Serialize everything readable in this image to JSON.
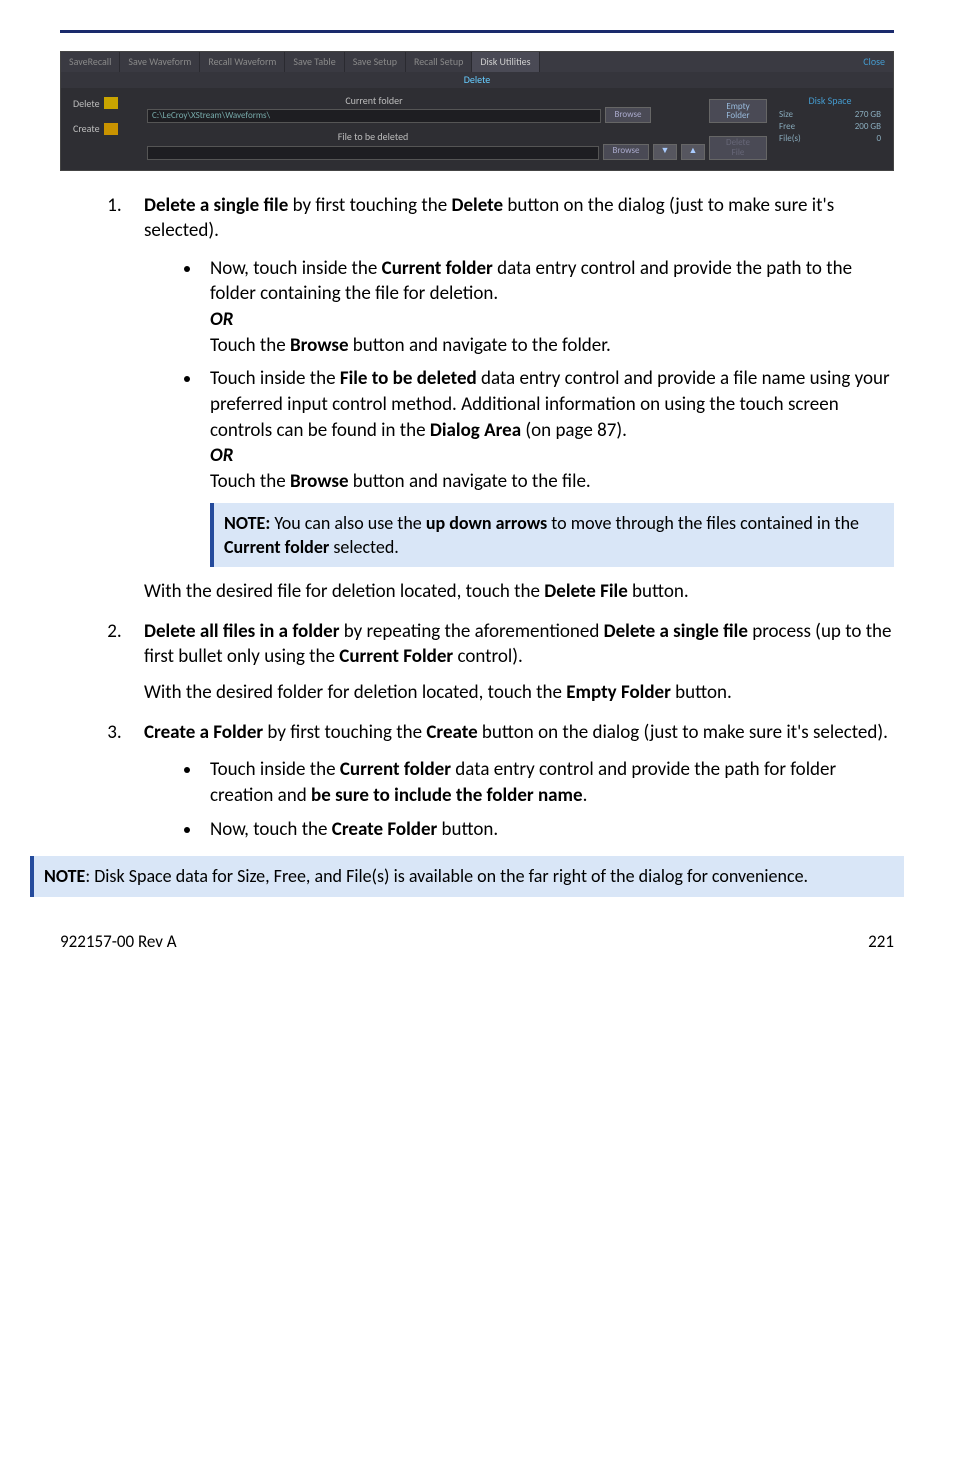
{
  "appshot": {
    "tabs": [
      {
        "label": "SaveRecall"
      },
      {
        "label": "Save Waveform"
      },
      {
        "label": "Recall Waveform"
      },
      {
        "label": "Save Table"
      },
      {
        "label": "Save Setup"
      },
      {
        "label": "Recall Setup"
      },
      {
        "label": "Disk Utilities",
        "active": true
      }
    ],
    "close": "Close",
    "subbar": "Delete",
    "side": {
      "delete": "Delete",
      "create": "Create"
    },
    "fields": {
      "current_folder_label": "Current folder",
      "current_folder_value": "C:\\LeCroy\\XStream\\Waveforms\\",
      "file_label": "File to be deleted",
      "browse": "Browse"
    },
    "actions": {
      "empty": "Empty\nFolder",
      "delete_file": "Delete\nFile"
    },
    "diskspace": {
      "header": "Disk Space",
      "size_l": "Size",
      "size_v": "270 GB",
      "free_l": "Free",
      "free_v": "200 GB",
      "files_l": "File(s)",
      "files_v": "0"
    }
  },
  "step1_lead_a": "Delete a single file",
  "step1_lead_b": " by first touching the ",
  "step1_lead_c": "Delete",
  "step1_lead_d": " button on the dialog (just to make sure it's selected).",
  "s1b1_a": "Now, touch inside the ",
  "s1b1_b": "Current folder",
  "s1b1_c": " data entry control and provide the path to the folder containing the file for deletion.",
  "or": "OR",
  "s1b1_d": "Touch the ",
  "s1b1_e": "Browse",
  "s1b1_f": " button and navigate to the folder.",
  "s1b2_a": "Touch inside the ",
  "s1b2_b": "File to be deleted",
  "s1b2_c": " data entry control and provide a file name using your preferred input control method. Additional information on using the touch screen controls can be found in the ",
  "s1b2_d": "Dialog Area",
  "s1b2_e": " (on page 87).",
  "s1b2_f": "Touch the ",
  "s1b2_g": "Browse",
  "s1b2_h": " button and navigate to the file.",
  "note1_a": "NOTE:",
  "note1_b": " You can also use the ",
  "note1_c": "up down arrows",
  "note1_d": " to move through the files contained in the ",
  "note1_e": "Current folder",
  "note1_f": " selected.",
  "s1after_a": "With the desired file for deletion located, touch the ",
  "s1after_b": "Delete File",
  "s1after_c": " button.",
  "step2_a": "Delete all files in a folder",
  "step2_b": " by repeating the aforementioned ",
  "step2_c": "Delete a single file",
  "step2_d": " process (up to the first bullet only using the ",
  "step2_e": "Current Folder",
  "step2_f": " control).",
  "step2_g": "With the desired folder for deletion located, touch the ",
  "step2_h": "Empty Folder",
  "step2_i": " button.",
  "step3_a": "Create a Folder",
  "step3_b": " by first touching the ",
  "step3_c": "Create",
  "step3_d": " button on the dialog (just to make sure it's selected).",
  "s3b1_a": "Touch inside the ",
  "s3b1_b": "Current folder",
  "s3b1_c": " data entry control and provide the path for folder creation and ",
  "s3b1_d": "be sure to include the folder name",
  "s3b1_e": ".",
  "s3b2_a": "Now, touch the ",
  "s3b2_b": "Create Folder",
  "s3b2_c": " button.",
  "note2_a": "NOTE",
  "note2_b": ": Disk Space data for Size, Free, and File(s) is available on the far right of the dialog for convenience.",
  "footer_left": "922157-00 Rev A",
  "footer_right": "221"
}
